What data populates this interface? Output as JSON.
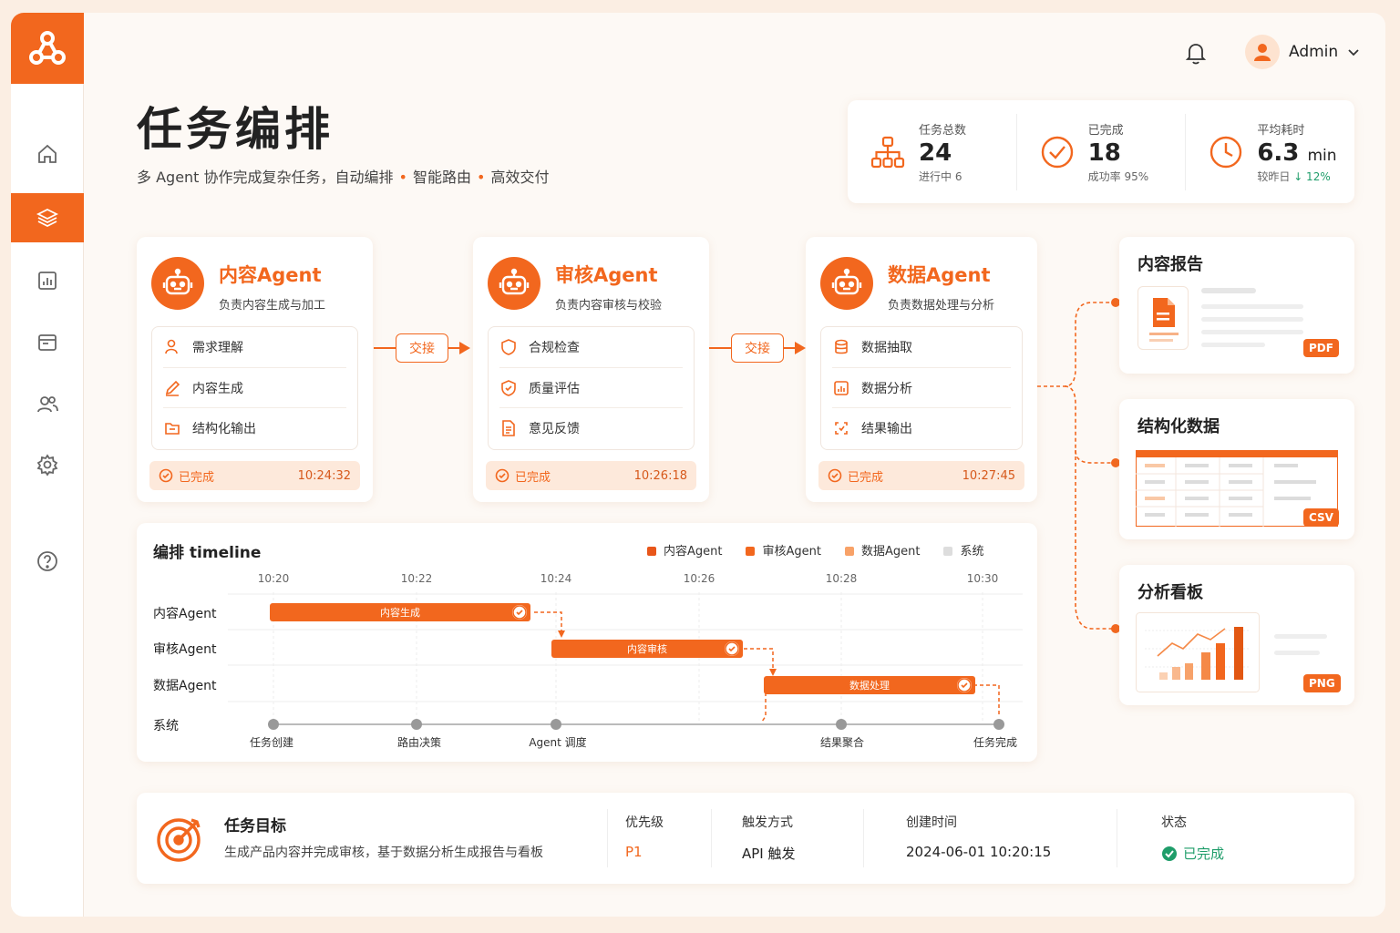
{
  "header": {
    "title": "任务编排",
    "subtitle_parts": [
      "多 Agent 协作完成复杂任务，自动编排",
      "智能路由",
      "高效交付"
    ],
    "user_name": "Admin"
  },
  "stats": [
    {
      "label": "任务总数",
      "value": "24",
      "unit": "",
      "sub": "进行中 6"
    },
    {
      "label": "已完成",
      "value": "18",
      "unit": "",
      "sub": "成功率 95%"
    },
    {
      "label": "平均耗时",
      "value": "6.3",
      "unit": "min",
      "sub": "较昨日",
      "delta": "↓ 12%"
    }
  ],
  "agents": [
    {
      "name": "内容Agent",
      "desc": "负责内容生成与加工",
      "tasks": [
        "需求理解",
        "内容生成",
        "结构化输出"
      ],
      "status": "已完成",
      "time": "10:24:32"
    },
    {
      "name": "审核Agent",
      "desc": "负责内容审核与校验",
      "tasks": [
        "合规检查",
        "质量评估",
        "意见反馈"
      ],
      "status": "已完成",
      "time": "10:26:18"
    },
    {
      "name": "数据Agent",
      "desc": "负责数据处理与分析",
      "tasks": [
        "数据抽取",
        "数据分析",
        "结果输出"
      ],
      "status": "已完成",
      "time": "10:27:45"
    }
  ],
  "handoff_label": "交接",
  "outputs": [
    {
      "title": "内容报告",
      "badge": "PDF"
    },
    {
      "title": "结构化数据",
      "badge": "CSV"
    },
    {
      "title": "分析看板",
      "badge": "PNG"
    }
  ],
  "timeline": {
    "title": "编排 timeline",
    "legend": [
      "内容Agent",
      "审核Agent",
      "数据Agent",
      "系统"
    ],
    "ticks": [
      "10:20",
      "10:22",
      "10:24",
      "10:26",
      "10:28",
      "10:30"
    ],
    "rows": [
      "内容Agent",
      "审核Agent",
      "数据Agent",
      "系统"
    ],
    "bars": [
      {
        "label": "内容生成",
        "row": 0,
        "start": "10:20",
        "end": "10:24"
      },
      {
        "label": "内容审核",
        "row": 1,
        "start": "10:24",
        "end": "10:27"
      },
      {
        "label": "数据处理",
        "row": 2,
        "start": "10:27",
        "end": "10:30"
      }
    ],
    "milestones": [
      "任务创建",
      "路由决策",
      "Agent 调度",
      "结果聚合",
      "任务完成"
    ]
  },
  "goal": {
    "title": "任务目标",
    "desc": "生成产品内容并完成审核，基于数据分析生成报告与看板",
    "priority_label": "优先级",
    "priority": "P1",
    "trigger_label": "触发方式",
    "trigger": "API 触发",
    "created_label": "创建时间",
    "created": "2024-06-01  10:20:15",
    "status_label": "状态",
    "status": "已完成"
  },
  "colors": {
    "accent": "#f2671e",
    "success": "#1f9d6a"
  }
}
